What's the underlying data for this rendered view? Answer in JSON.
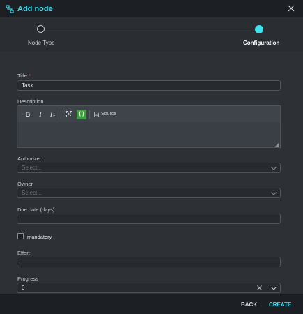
{
  "header": {
    "title": "Add node",
    "logo_icon": "flow-icon",
    "close_icon": "close-icon"
  },
  "stepper": {
    "steps": [
      {
        "label": "Node Type",
        "state": "done"
      },
      {
        "label": "Configuration",
        "state": "active"
      }
    ]
  },
  "form": {
    "title": {
      "label": "Title",
      "required_mark": "*",
      "value": "Task"
    },
    "description": {
      "label": "Description",
      "toolbar": {
        "bold": "B",
        "italic": "I",
        "clear_format": "Ix",
        "maximize_icon": "maximize-icon",
        "code": "{ }",
        "source_label": "Source"
      },
      "value": ""
    },
    "authorizer": {
      "label": "Authorizer",
      "placeholder": "Select..."
    },
    "owner": {
      "label": "Owner",
      "placeholder": "Select..."
    },
    "due_date": {
      "label": "Due date (days)",
      "value": ""
    },
    "mandatory": {
      "label": "mandatory",
      "checked": false
    },
    "effort": {
      "label": "Effort",
      "value": ""
    },
    "progress": {
      "label": "Progress",
      "value": "0"
    }
  },
  "footer": {
    "back_label": "BACK",
    "create_label": "CREATE"
  },
  "colors": {
    "accent": "#40d9e8",
    "required": "#e0554e",
    "code_button": "#3f9a3f"
  }
}
